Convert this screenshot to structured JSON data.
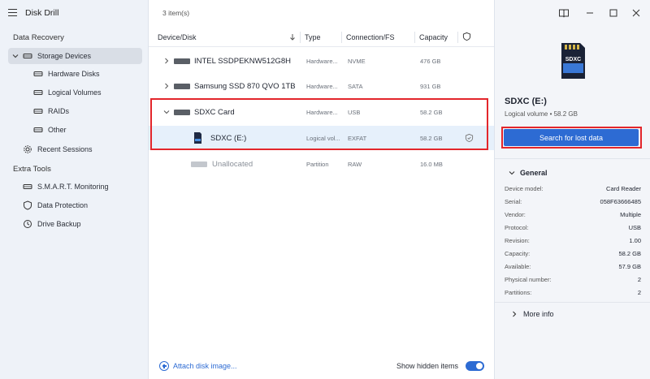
{
  "app": {
    "title": "Disk Drill"
  },
  "sidebar": {
    "sections": [
      {
        "title": "Data Recovery"
      },
      {
        "title": "Extra Tools"
      }
    ],
    "items": [
      {
        "label": "Storage Devices",
        "icon": "drive-icon",
        "selected": true
      },
      {
        "label": "Hardware Disks",
        "icon": "drive-icon"
      },
      {
        "label": "Logical Volumes",
        "icon": "drive-icon"
      },
      {
        "label": "RAIDs",
        "icon": "drive-icon"
      },
      {
        "label": "Other",
        "icon": "drive-icon"
      },
      {
        "label": "Recent Sessions",
        "icon": "gear-icon"
      },
      {
        "label": "S.M.A.R.T. Monitoring",
        "icon": "drive-icon"
      },
      {
        "label": "Data Protection",
        "icon": "shield-icon"
      },
      {
        "label": "Drive Backup",
        "icon": "clock-icon"
      }
    ]
  },
  "main": {
    "items_count": "3 item(s)",
    "columns": [
      "Device/Disk",
      "Type",
      "Connection/FS",
      "Capacity"
    ],
    "rows": [
      {
        "name": "INTEL SSDPEKNW512G8H",
        "type": "Hardware...",
        "conn": "NVME",
        "cap": "476 GB"
      },
      {
        "name": "Samsung SSD 870 QVO 1TB",
        "type": "Hardware...",
        "conn": "SATA",
        "cap": "931 GB"
      },
      {
        "name": "SDXC Card",
        "type": "Hardware...",
        "conn": "USB",
        "cap": "58.2 GB"
      },
      {
        "name": "SDXC (E:)",
        "type": "Logical vol...",
        "conn": "EXFAT",
        "cap": "58.2 GB"
      },
      {
        "name": "Unallocated",
        "type": "Partition",
        "conn": "RAW",
        "cap": "16.0 MB"
      }
    ],
    "attach_label": "Attach disk image...",
    "show_hidden_label": "Show hidden items"
  },
  "details": {
    "card_label": "SDXC",
    "title": "SDXC (E:)",
    "subtitle": "Logical volume • 58.2 GB",
    "search_button": "Search for lost data",
    "general_label": "General",
    "properties": [
      {
        "key": "Device model:",
        "value": "Card  Reader"
      },
      {
        "key": "Serial:",
        "value": "058F63666485"
      },
      {
        "key": "Vendor:",
        "value": "Multiple"
      },
      {
        "key": "Protocol:",
        "value": "USB"
      },
      {
        "key": "Revision:",
        "value": "1.00"
      },
      {
        "key": "Capacity:",
        "value": "58.2 GB"
      },
      {
        "key": "Available:",
        "value": "57.9 GB"
      },
      {
        "key": "Physical number:",
        "value": "2"
      },
      {
        "key": "Partitions:",
        "value": "2"
      }
    ],
    "more_info_label": "More info"
  },
  "colors": {
    "accent": "#2d6bd3",
    "highlight": "#e3262b"
  }
}
